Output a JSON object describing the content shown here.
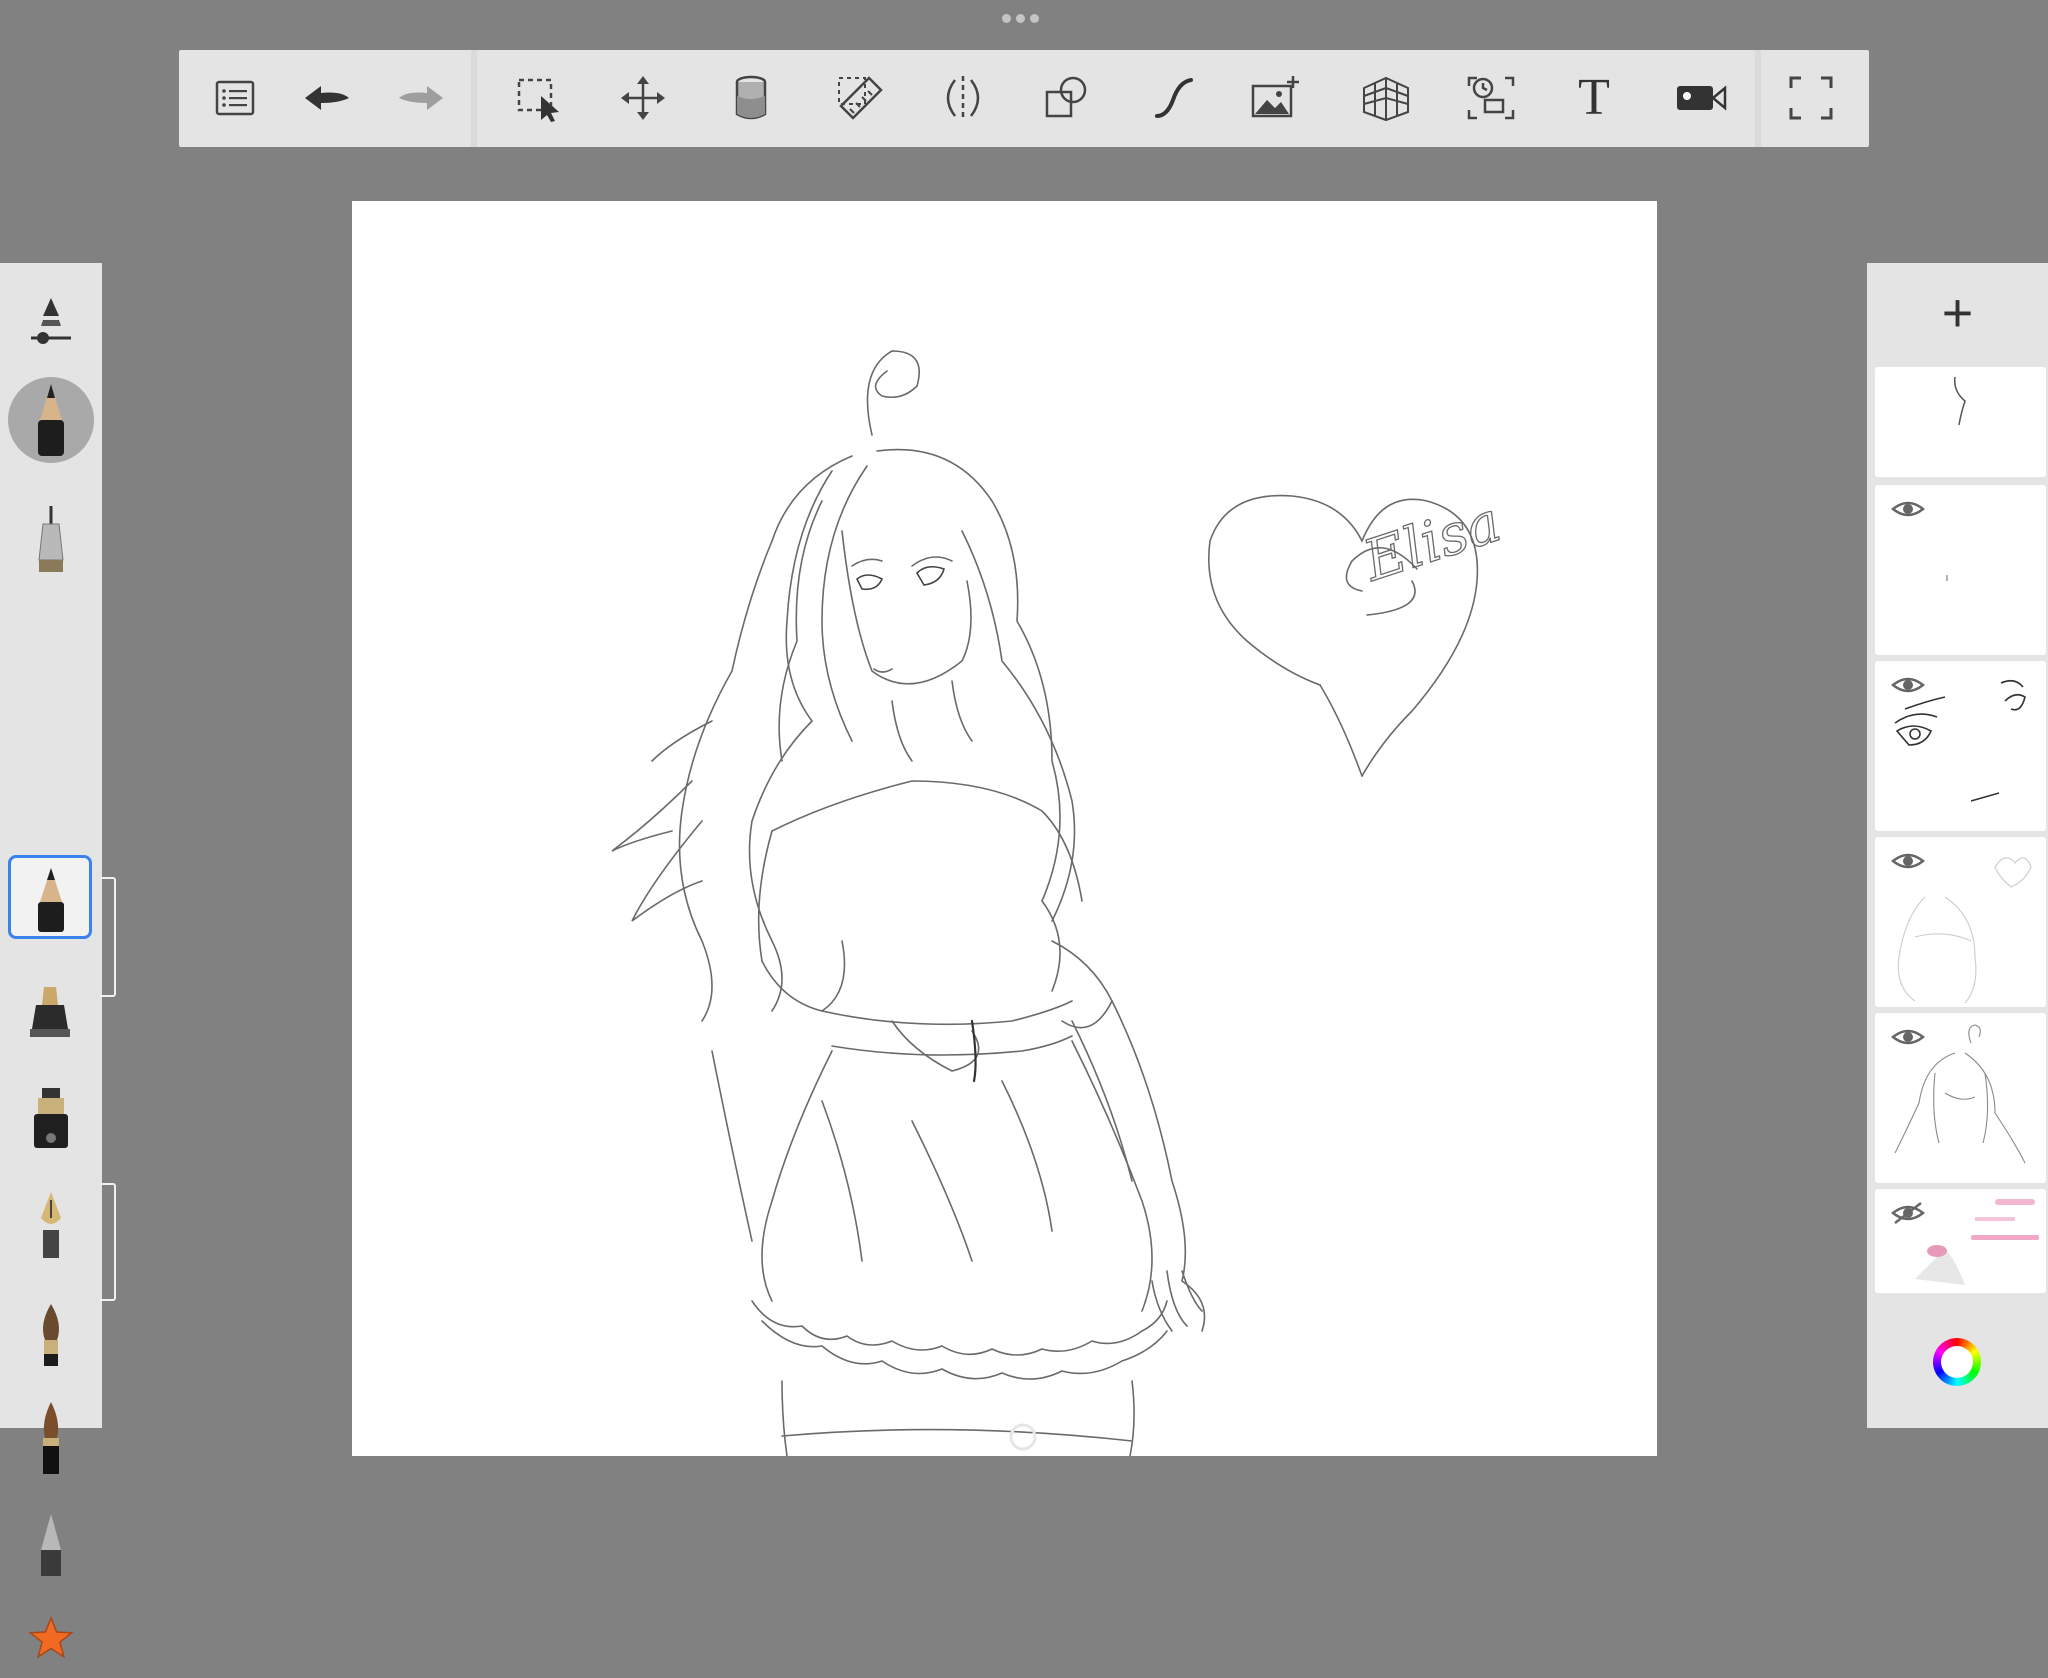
{
  "app": {
    "toolbar": {
      "items": [
        {
          "name": "menu-list-icon"
        },
        {
          "name": "undo-icon"
        },
        {
          "name": "redo-icon"
        },
        {
          "name": "selection-icon"
        },
        {
          "name": "transform-move-icon"
        },
        {
          "name": "fill-bucket-icon"
        },
        {
          "name": "ruler-icon"
        },
        {
          "name": "symmetry-icon"
        },
        {
          "name": "shapes-icon"
        },
        {
          "name": "stroke-icon"
        },
        {
          "name": "add-image-icon"
        },
        {
          "name": "perspective-grid-icon"
        },
        {
          "name": "time-lapse-icon"
        },
        {
          "name": "text-icon"
        },
        {
          "name": "record-video-icon"
        },
        {
          "name": "fullscreen-icon"
        }
      ],
      "text_tool_glyph": "T"
    },
    "canvas": {
      "heart_text": "Elisa"
    },
    "brushes": [
      {
        "name": "brush-properties-icon"
      },
      {
        "name": "current-pencil-icon"
      },
      {
        "name": "technical-pen-icon"
      },
      {
        "name": "pencil-icon",
        "selected": true
      },
      {
        "name": "marker-icon"
      },
      {
        "name": "ink-pen-icon"
      },
      {
        "name": "fountain-pen-icon"
      },
      {
        "name": "paintbrush-icon"
      },
      {
        "name": "ink-brush-icon"
      },
      {
        "name": "eraser-icon"
      },
      {
        "name": "favorites-star-icon"
      }
    ],
    "layers": {
      "add_glyph": "+",
      "items": [
        {
          "name": "layer-1",
          "visible": true
        },
        {
          "name": "layer-2",
          "visible": true
        },
        {
          "name": "layer-3",
          "visible": true
        },
        {
          "name": "layer-4",
          "visible": true
        },
        {
          "name": "layer-5",
          "visible": true
        },
        {
          "name": "layer-6",
          "visible": false
        }
      ]
    },
    "colors": {
      "background": "#818181",
      "panel": "#e4e4e4",
      "selection_accent": "#3a82f0",
      "star": "#f26a21"
    }
  }
}
